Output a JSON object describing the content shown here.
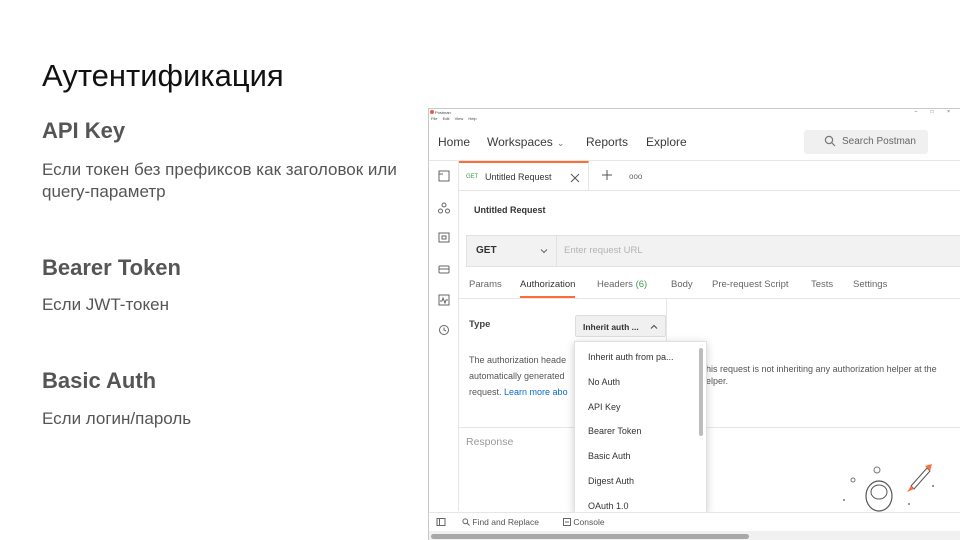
{
  "slide": {
    "title": "Аутентификация",
    "sections": [
      {
        "heading": "API Key",
        "text": "Если токен без префиксов как заголовок или query-параметр"
      },
      {
        "heading": "Bearer Token",
        "text": "Если JWT-токен"
      },
      {
        "heading": "Basic Auth",
        "text": "Если логин/пароль"
      }
    ]
  },
  "postman": {
    "window_title": "Postman",
    "menu": [
      "File",
      "Edit",
      "View",
      "Help"
    ],
    "window_controls": "– □ ×",
    "nav": {
      "home": "Home",
      "workspaces": "Workspaces",
      "reports": "Reports",
      "explore": "Explore"
    },
    "search_label": "Search Postman",
    "tab": {
      "method": "GET",
      "name": "Untitled Request",
      "more": "ooo"
    },
    "request_name": "Untitled Request",
    "method": "GET",
    "url_placeholder": "Enter request URL",
    "subtabs": [
      "Params",
      "Authorization",
      "Headers",
      "Body",
      "Pre-request Script",
      "Tests",
      "Settings"
    ],
    "headers_count": "(6)",
    "type_label": "Type",
    "auth_selected": "Inherit auth ...",
    "auth_desc": {
      "line1": "The authorization heade",
      "line2": "automatically generated",
      "line3_prefix": "request. ",
      "learn_more": "Learn more abo"
    },
    "inherit_text": "his request is not inheriting any authorization helper at the elper.",
    "auth_options": [
      "Inherit auth from pa...",
      "No Auth",
      "API Key",
      "Bearer Token",
      "Basic Auth",
      "Digest Auth",
      "OAuth 1.0"
    ],
    "response_label": "Response",
    "statusbar": {
      "find": "Find and Replace",
      "console": "Console"
    },
    "colors": {
      "accent": "#ff6c37",
      "get_method": "#3f9d4b",
      "link": "#0b6bcb"
    }
  }
}
